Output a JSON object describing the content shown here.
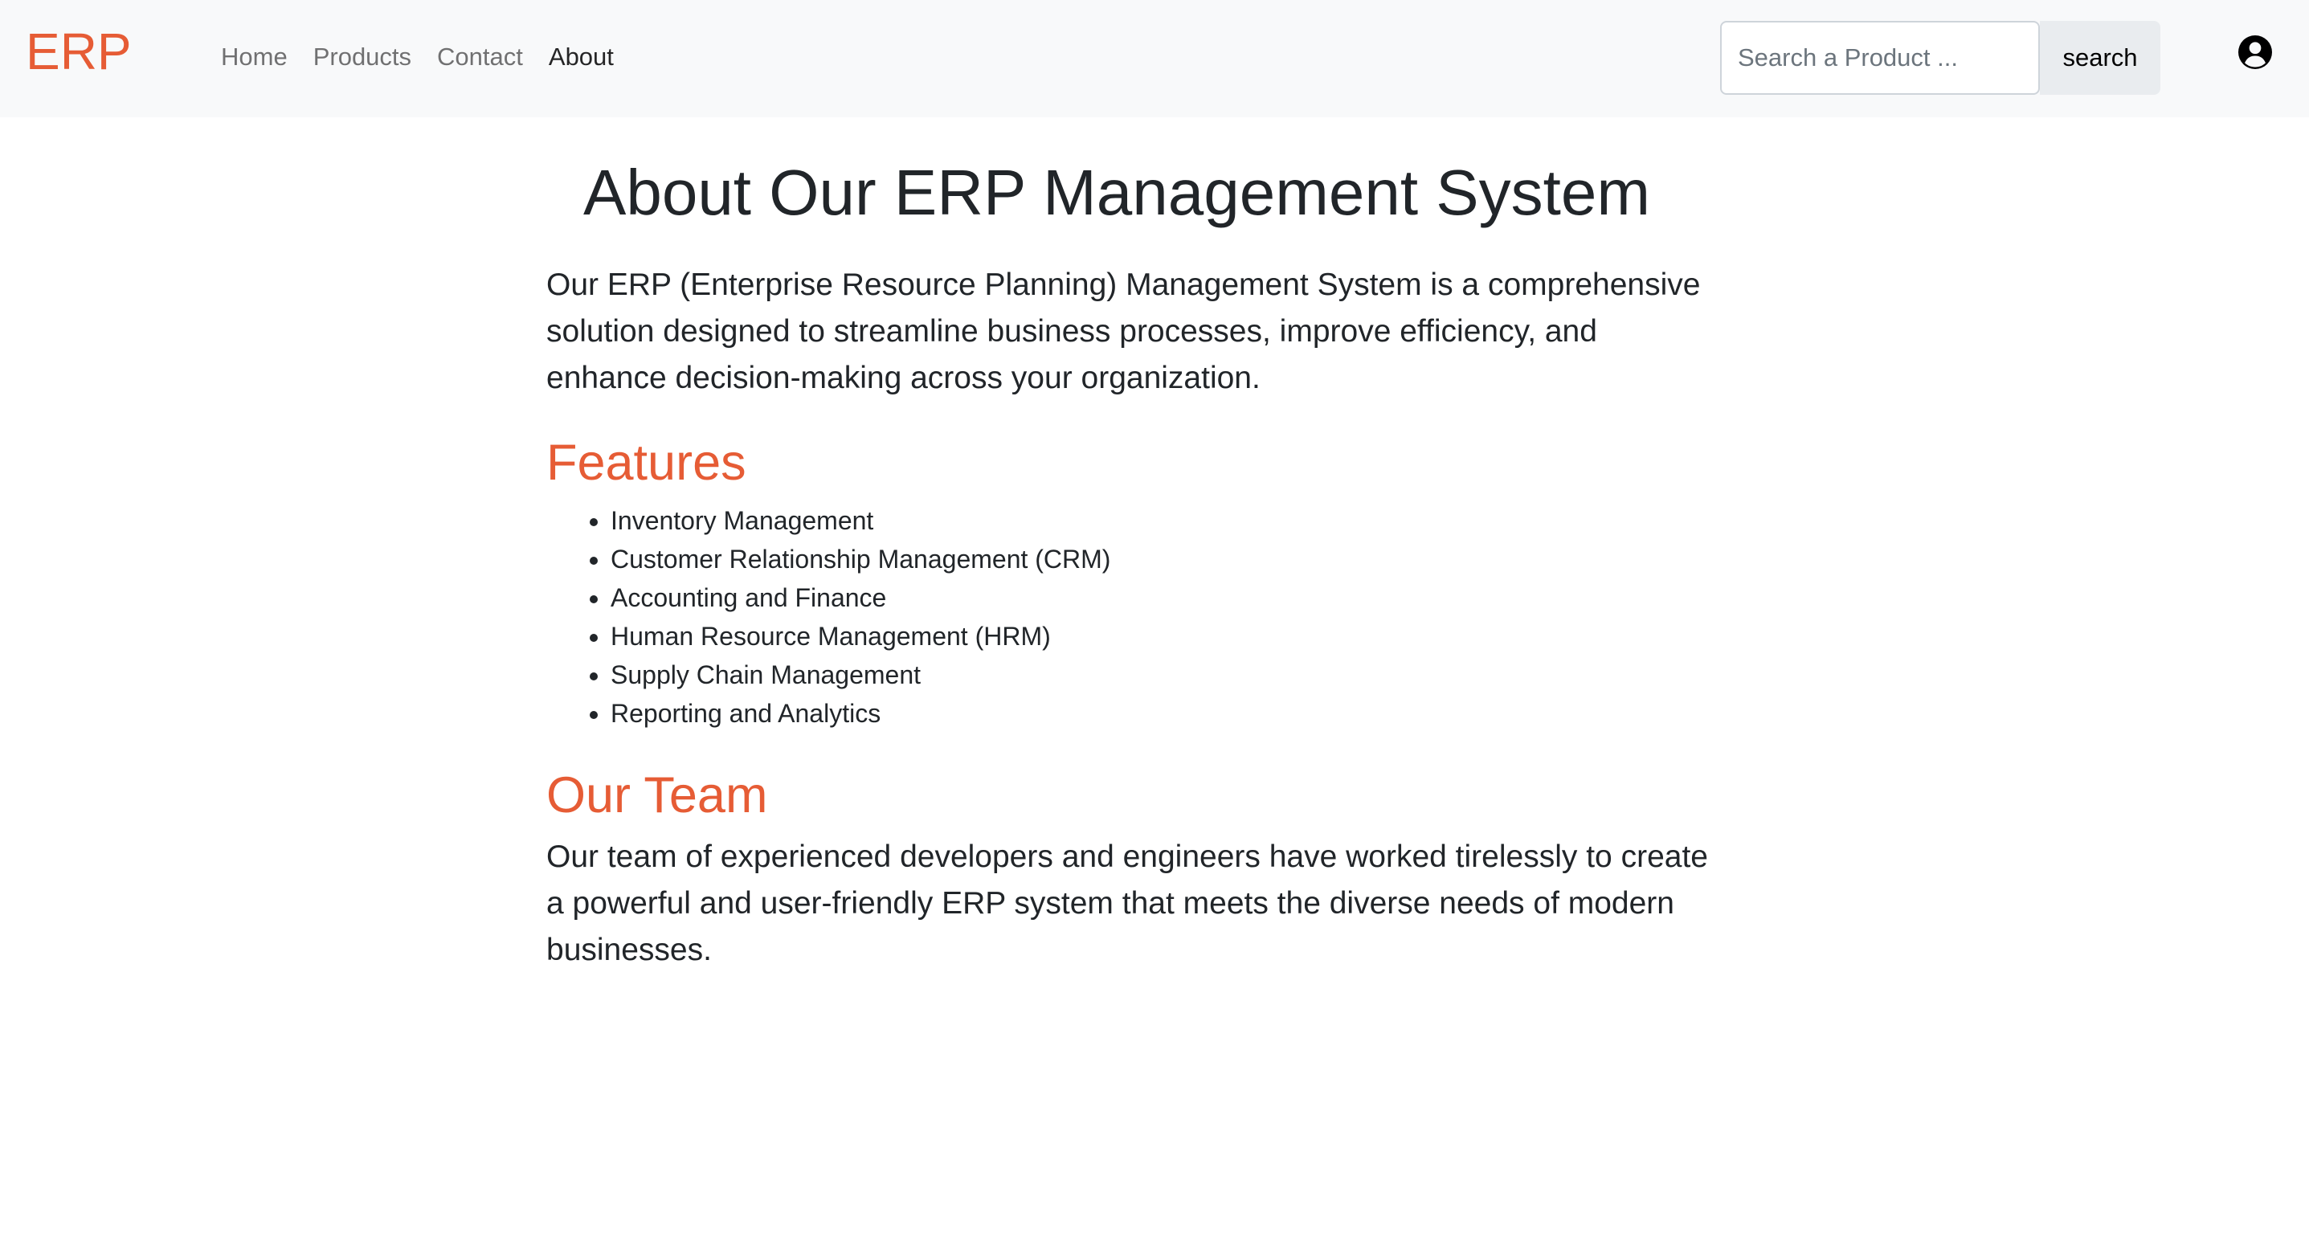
{
  "navbar": {
    "brand": "ERP",
    "links": [
      {
        "label": "Home",
        "active": false
      },
      {
        "label": "Products",
        "active": false
      },
      {
        "label": "Contact",
        "active": false
      },
      {
        "label": "About",
        "active": true
      }
    ],
    "search": {
      "placeholder": "Search a Product ...",
      "value": "",
      "button_label": "search"
    },
    "account_icon": "user-circle-icon"
  },
  "main": {
    "title": "About Our ERP Management System",
    "intro": "Our ERP (Enterprise Resource Planning) Management System is a comprehensive solution designed to streamline business processes, improve efficiency, and enhance decision-making across your organization.",
    "features": {
      "heading": "Features",
      "items": [
        "Inventory Management",
        "Customer Relationship Management (CRM)",
        "Accounting and Finance",
        "Human Resource Management (HRM)",
        "Supply Chain Management",
        "Reporting and Analytics"
      ]
    },
    "team": {
      "heading": "Our Team",
      "text": "Our team of experienced developers and engineers have worked tirelessly to create a powerful and user-friendly ERP system that meets the diverse needs of modern businesses."
    }
  },
  "colors": {
    "accent": "#e65c35",
    "navbar_bg": "#f8f9fa",
    "text": "#212529"
  }
}
